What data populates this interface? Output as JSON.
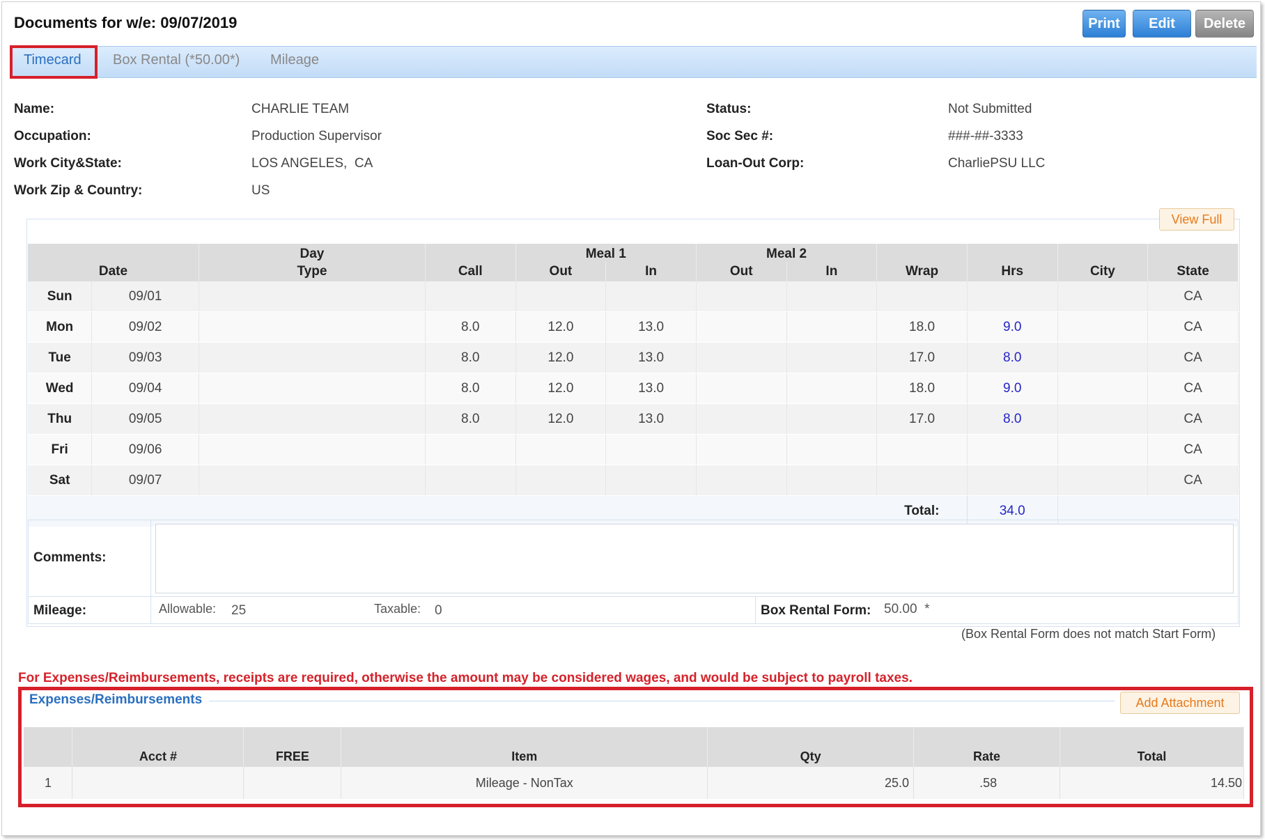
{
  "header": {
    "title": "Documents for w/e: 09/07/2019",
    "buttons": {
      "print": "Print",
      "edit": "Edit",
      "delete": "Delete"
    }
  },
  "tabs": [
    "Timecard",
    "Box Rental (*50.00*)",
    "Mileage"
  ],
  "info": {
    "name_label": "Name:",
    "name": "CHARLIE TEAM",
    "occupation_label": "Occupation:",
    "occupation": "Production Supervisor",
    "workcity_label": "Work City&State:",
    "workcity": "LOS ANGELES,  CA",
    "workzip_label": "Work Zip & Country:",
    "workzip": "US",
    "status_label": "Status:",
    "status": "Not Submitted",
    "ssn_label": "Soc Sec #:",
    "ssn": "###-##-3333",
    "loanout_label": "Loan-Out Corp:",
    "loanout": "CharliePSU LLC"
  },
  "timecard": {
    "view_full": "View Full",
    "group_headers": {
      "day": "Day",
      "meal1": "Meal 1",
      "meal2": "Meal 2"
    },
    "columns": {
      "date": "Date",
      "type": "Type",
      "call": "Call",
      "m1out": "Out",
      "m1in": "In",
      "m2out": "Out",
      "m2in": "In",
      "wrap": "Wrap",
      "hrs": "Hrs",
      "city": "City",
      "state": "State"
    },
    "rows": [
      {
        "day": "Sun",
        "date": "09/01",
        "call": "",
        "m1out": "",
        "m1in": "",
        "wrap": "",
        "hrs": "",
        "state": "CA"
      },
      {
        "day": "Mon",
        "date": "09/02",
        "call": "8.0",
        "m1out": "12.0",
        "m1in": "13.0",
        "wrap": "18.0",
        "hrs": "9.0",
        "state": "CA"
      },
      {
        "day": "Tue",
        "date": "09/03",
        "call": "8.0",
        "m1out": "12.0",
        "m1in": "13.0",
        "wrap": "17.0",
        "hrs": "8.0",
        "state": "CA"
      },
      {
        "day": "Wed",
        "date": "09/04",
        "call": "8.0",
        "m1out": "12.0",
        "m1in": "13.0",
        "wrap": "18.0",
        "hrs": "9.0",
        "state": "CA"
      },
      {
        "day": "Thu",
        "date": "09/05",
        "call": "8.0",
        "m1out": "12.0",
        "m1in": "13.0",
        "wrap": "17.0",
        "hrs": "8.0",
        "state": "CA"
      },
      {
        "day": "Fri",
        "date": "09/06",
        "call": "",
        "m1out": "",
        "m1in": "",
        "wrap": "",
        "hrs": "",
        "state": "CA"
      },
      {
        "day": "Sat",
        "date": "09/07",
        "call": "",
        "m1out": "",
        "m1in": "",
        "wrap": "",
        "hrs": "",
        "state": "CA"
      }
    ],
    "total_label": "Total:",
    "total": "34.0"
  },
  "comments": {
    "comments_label": "Comments:",
    "mileage_label": "Mileage:",
    "allowable_label": "Allowable:",
    "allowable": "25",
    "taxable_label": "Taxable:",
    "taxable": "0",
    "box_rental_label": "Box Rental Form:",
    "box_rental": "50.00  *",
    "mismatch_note": "(Box Rental Form does not match Start Form)"
  },
  "expenses": {
    "warning": "For Expenses/Reimbursements, receipts are required, otherwise the amount may be considered wages, and would be subject to payroll taxes.",
    "title": "Expenses/Reimbursements",
    "add_attachment": "Add Attachment",
    "columns": {
      "acct": "Acct #",
      "free": "FREE",
      "item": "Item",
      "qty": "Qty",
      "rate": "Rate",
      "total": "Total"
    },
    "rows": [
      {
        "num": "1",
        "acct": "",
        "free": "",
        "item": "Mileage - NonTax",
        "qty": "25.0",
        "rate": ".58",
        "total": "14.50"
      }
    ]
  },
  "colors": {
    "accent_blue": "#2a6fbf",
    "highlight_red": "#d6202a",
    "hours_blue": "#2525c8",
    "orange": "#e57a1d"
  }
}
